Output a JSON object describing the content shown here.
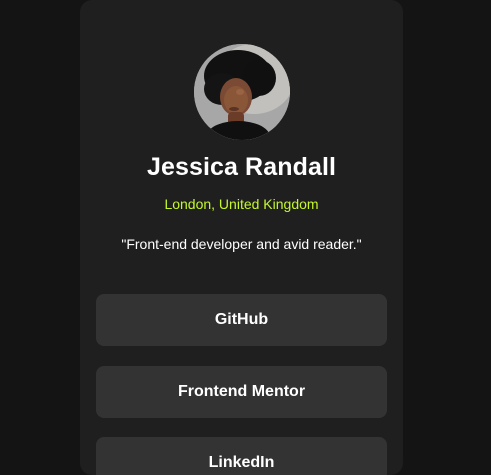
{
  "profile": {
    "name": "Jessica Randall",
    "location": "London, United Kingdom",
    "bio": "\"Front-end developer and avid reader.\""
  },
  "links": [
    {
      "label": "GitHub"
    },
    {
      "label": "Frontend Mentor"
    },
    {
      "label": "LinkedIn"
    }
  ],
  "colors": {
    "page_background": "#141414",
    "card_background": "#1f1f1f",
    "button_background": "#333333",
    "accent": "#c4f82a",
    "text": "#ffffff"
  }
}
